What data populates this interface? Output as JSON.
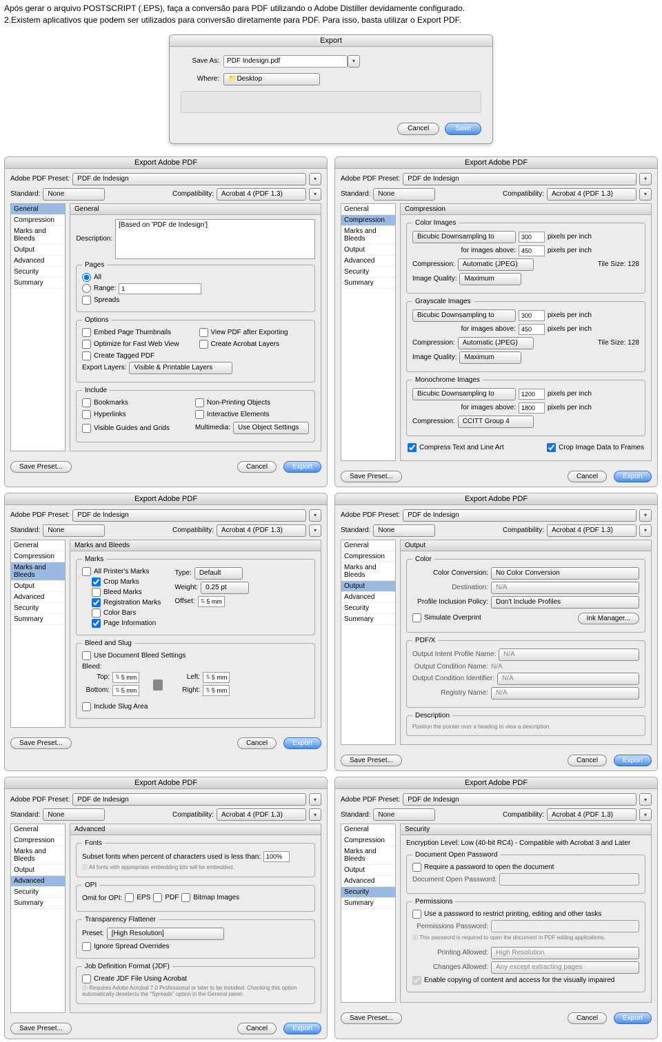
{
  "intro": {
    "p1": "Após gerar o arquivo POSTSCRIPT (.EPS), faça a conversão para PDF utilizando o Adobe Distiller devidamente configurado.",
    "p2": "2.Existem aplicativos que podem ser utilizados para conversão diretamente para PDF. Para isso, basta utilizar o Export PDF."
  },
  "exportDlg": {
    "title": "Export",
    "saveAsLabel": "Save As:",
    "saveAsValue": "PDF Indesign.pdf",
    "whereLabel": "Where:",
    "whereValue": "Desktop",
    "cancel": "Cancel",
    "save": "Save"
  },
  "common": {
    "panelTitle": "Export Adobe PDF",
    "presetLabel": "Adobe PDF Preset:",
    "presetValue": "PDF de Indesign",
    "standardLabel": "Standard:",
    "standardValue": "None",
    "compatLabel": "Compatibility:",
    "compatValue": "Acrobat 4 (PDF 1.3)",
    "sidebar": [
      "General",
      "Compression",
      "Marks and Bleeds",
      "Output",
      "Advanced",
      "Security",
      "Summary"
    ],
    "savePreset": "Save Preset...",
    "cancel": "Cancel",
    "export": "Export"
  },
  "general": {
    "hdr": "General",
    "descLabel": "Description:",
    "descValue": "[Based on 'PDF de Indesign']",
    "pages": "Pages",
    "all": "All",
    "range": "Range:",
    "rangeVal": "1",
    "spreads": "Spreads",
    "options": "Options",
    "embed": "Embed Page Thumbnails",
    "optimize": "Optimize for Fast Web View",
    "tagged": "Create Tagged PDF",
    "viewAfter": "View PDF after Exporting",
    "acroLayers": "Create Acrobat Layers",
    "exportLayersLabel": "Export Layers:",
    "exportLayersVal": "Visible & Printable Layers",
    "include": "Include",
    "bookmarks": "Bookmarks",
    "hyperlinks": "Hyperlinks",
    "visibleGuides": "Visible Guides and Grids",
    "nonPrinting": "Non-Printing Objects",
    "interactive": "Interactive Elements",
    "multimediaLabel": "Multimedia:",
    "multimediaVal": "Use Object Settings"
  },
  "compression": {
    "hdr": "Compression",
    "colorImages": "Color Images",
    "grayImages": "Grayscale Images",
    "monoImages": "Monochrome Images",
    "downsample": "Bicubic Downsampling to",
    "ppi": "pixels per inch",
    "forAbove": "for images above:",
    "compressionLabel": "Compression:",
    "autoJpeg": "Automatic (JPEG)",
    "tileSize": "Tile Size:",
    "tileVal": "128",
    "imgQuality": "Image Quality:",
    "maximum": "Maximum",
    "color_ds": "300",
    "color_above": "450",
    "gray_ds": "300",
    "gray_above": "450",
    "mono_ds": "1200",
    "mono_above": "1800",
    "ccitt": "CCITT Group 4",
    "compressText": "Compress Text and Line Art",
    "cropFrames": "Crop Image Data to Frames"
  },
  "marks": {
    "hdr": "Marks and Bleeds",
    "marks": "Marks",
    "allMarks": "All Printer's Marks",
    "crop": "Crop Marks",
    "bleedMarks": "Bleed Marks",
    "reg": "Registration Marks",
    "colorBars": "Color Bars",
    "pageInfo": "Page Information",
    "typeLabel": "Type:",
    "typeVal": "Default",
    "weightLabel": "Weight:",
    "weightVal": "0.25 pt",
    "offsetLabel": "Offset:",
    "offsetVal": "5 mm",
    "bleedSlug": "Bleed and Slug",
    "useDoc": "Use Document Bleed Settings",
    "bleed": "Bleed:",
    "top": "Top:",
    "bottom": "Bottom:",
    "left": "Left:",
    "right": "Right:",
    "bval": "5 mm",
    "slug": "Include Slug Area"
  },
  "output": {
    "hdr": "Output",
    "color": "Color",
    "colorConv": "Color Conversion:",
    "noConv": "No Color Conversion",
    "dest": "Destination:",
    "na": "N/A",
    "profile": "Profile Inclusion Policy:",
    "dontInclude": "Don't Include Profiles",
    "simOver": "Simulate Overprint",
    "inkMgr": "Ink Manager...",
    "pdfx": "PDF/X",
    "intentName": "Output Intent Profile Name:",
    "condName": "Output Condition Name:",
    "condId": "Output Condition Identifier:",
    "regName": "Registry Name:",
    "description": "Description",
    "descHint": "Position the pointer over a heading to view a description."
  },
  "advanced": {
    "hdr": "Advanced",
    "fonts": "Fonts",
    "subset": "Subset fonts when percent of characters used is less than:",
    "subsetVal": "100%",
    "fontsNote": "All fonts with appropriate embedding bits will be embedded.",
    "opi": "OPI",
    "omit": "Omit for OPI:",
    "eps": "EPS",
    "pdf": "PDF",
    "bitmap": "Bitmap Images",
    "trans": "Transparency Flattener",
    "presetLabel": "Preset:",
    "presetVal": "[High Resolution]",
    "ignore": "Ignore Spread Overrides",
    "jdf": "Job Definition Format (JDF)",
    "createJdf": "Create JDF File Using Acrobat",
    "jdfNote": "Requires Adobe Acrobat 7.0 Professional or later to be installed. Checking this option automatically deselects the \"Spreads\" option in the General panel."
  },
  "security": {
    "hdr": "Security",
    "enc": "Encryption Level: Low (40-bit RC4) - Compatible with Acrobat 3 and Later",
    "docOpen": "Document Open Password",
    "requirePw": "Require a password to open the document",
    "docOpenPw": "Document Open Password:",
    "perms": "Permissions",
    "usePw": "Use a password to restrict printing, editing and other tasks",
    "permPw": "Permissions Password:",
    "pwNote": "This password is required to open the document in PDF editing applications.",
    "printAllowed": "Printing Allowed:",
    "printVal": "High Resolution",
    "changesAllowed": "Changes Allowed:",
    "changesVal": "Any except extracting pages",
    "enableCopy": "Enable copying of content and access for the visually impaired"
  }
}
